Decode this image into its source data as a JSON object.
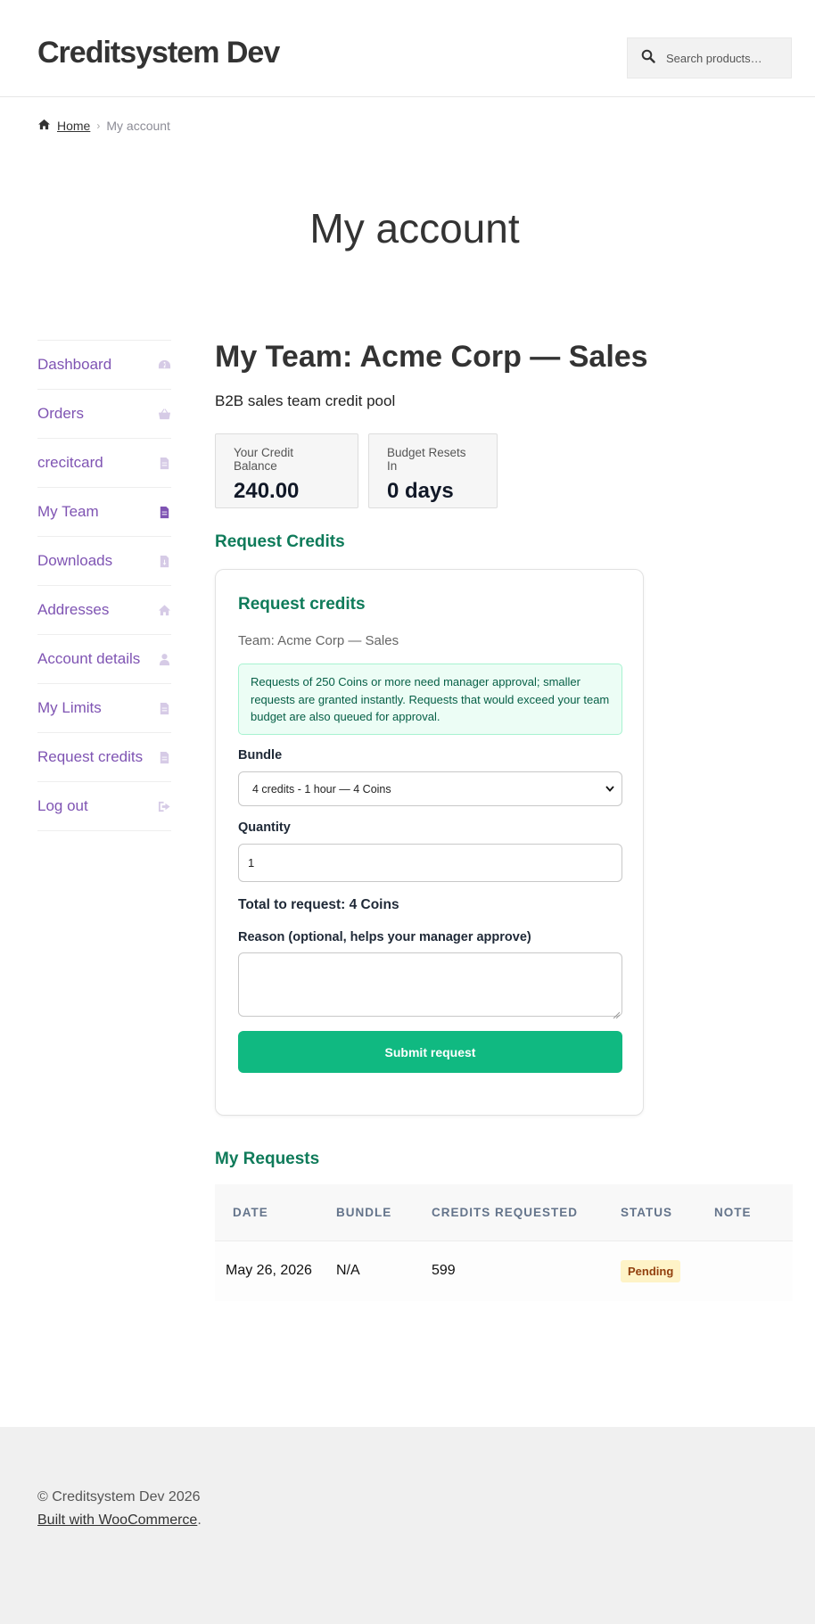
{
  "site": {
    "title": "Creditsystem Dev"
  },
  "search": {
    "placeholder": "Search products…"
  },
  "breadcrumb": {
    "home": "Home",
    "separator": "›",
    "current": "My account"
  },
  "page_title": "My account",
  "nav": {
    "items": [
      {
        "label": "Dashboard",
        "icon": "dashboard-icon"
      },
      {
        "label": "Orders",
        "icon": "basket-icon"
      },
      {
        "label": "crecitcard",
        "icon": "file-icon"
      },
      {
        "label": "My Team",
        "icon": "file-icon",
        "active": true
      },
      {
        "label": "Downloads",
        "icon": "file-download-icon"
      },
      {
        "label": "Addresses",
        "icon": "home-icon"
      },
      {
        "label": "Account details",
        "icon": "user-icon"
      },
      {
        "label": "My Limits",
        "icon": "file-icon"
      },
      {
        "label": "Request credits",
        "icon": "file-icon"
      },
      {
        "label": "Log out",
        "icon": "logout-icon"
      }
    ]
  },
  "team": {
    "title": "My Team: Acme Corp — Sales",
    "description": "B2B sales team credit pool"
  },
  "stats": {
    "balance_label": "Your Credit Balance",
    "balance_value": "240.00",
    "reset_label": "Budget Resets In",
    "reset_value": "0 days"
  },
  "request_section": {
    "heading": "Request Credits",
    "card_title": "Request credits",
    "team_line": "Team: Acme Corp — Sales",
    "notice": "Requests of 250 Coins or more need manager approval; smaller requests are granted instantly. Requests that would exceed your team budget are also queued for approval.",
    "bundle_label": "Bundle",
    "bundle_selected": "4 credits - 1 hour — 4 Coins",
    "quantity_label": "Quantity",
    "quantity_value": "1",
    "total_line": "Total to request: 4 Coins",
    "reason_label": "Reason (optional, helps your manager approve)",
    "reason_value": "",
    "submit_label": "Submit request"
  },
  "requests": {
    "heading": "My Requests",
    "columns": [
      "DATE",
      "BUNDLE",
      "CREDITS REQUESTED",
      "STATUS",
      "NOTE"
    ],
    "rows": [
      {
        "date": "May 26, 2026",
        "bundle": "N/A",
        "credits": "599",
        "status": "Pending",
        "note": ""
      }
    ]
  },
  "footer": {
    "copyright": "© Creditsystem Dev 2026",
    "built_link": "Built with WooCommerce",
    "built_suffix": "."
  },
  "colors": {
    "accent_purple": "#7f54b3",
    "accent_green": "#10b981",
    "heading_green": "#0f7b5a",
    "pending_badge": "#fef3c7"
  }
}
